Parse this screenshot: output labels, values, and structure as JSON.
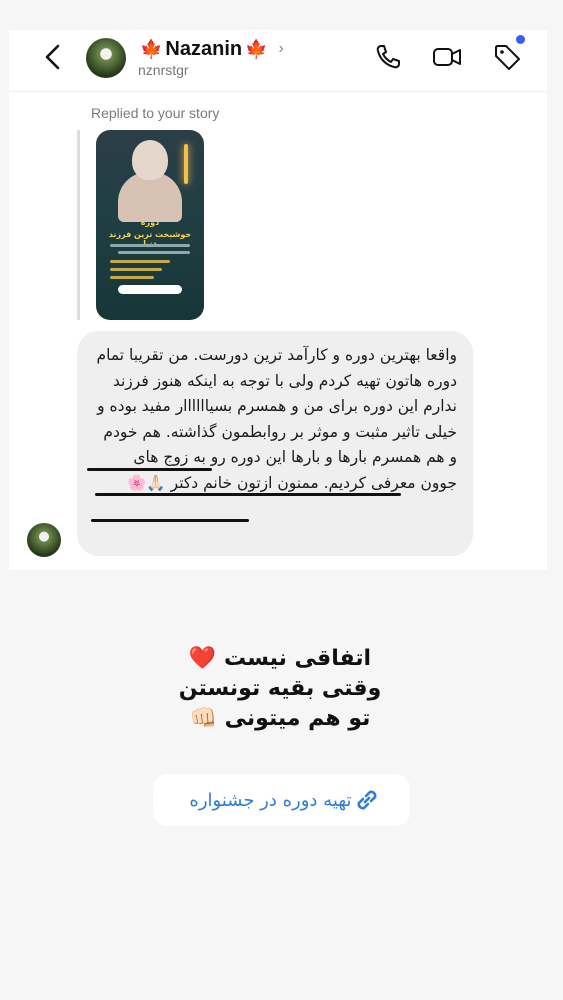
{
  "header": {
    "display_name": "Nazanin",
    "name_emoji": "🍁",
    "username": "nznrstgr",
    "icons": [
      "back-icon",
      "phone-icon",
      "video-icon",
      "tag-icon"
    ],
    "notification_dot_color": "#3a5cf0"
  },
  "reply": {
    "label": "Replied to your story",
    "story_title": "دوره",
    "story_subtitle": "خوشبخت ترین فرزند دنیا"
  },
  "message": {
    "text": "واقعا بهترین دوره و کارآمد ترین دورست. من تقریبا تمام دوره هاتون تهیه کردم ولی با توجه به اینکه هنوز فرزند ندارم این دوره برای من و همسرم بسیاااااار مفید بوده و خیلی تاثیر مثبت و موثر بر روابطمون گذاشته. هم خودم و هم همسرم بارها و بارها این دوره رو به زوج های جوون معرفی کردیم. ممنون ازتون خانم دکتر 🙏🏻🌸"
  },
  "overlay": {
    "line1": "اتفاقی نیست ❤️",
    "line2": "وقتی بقیه تونستن",
    "line3": "تو هم میتونی 👊🏻"
  },
  "link": {
    "label": "تهیه دوره در جشنواره",
    "icon": "link-icon",
    "color": "#2e7dd7"
  }
}
